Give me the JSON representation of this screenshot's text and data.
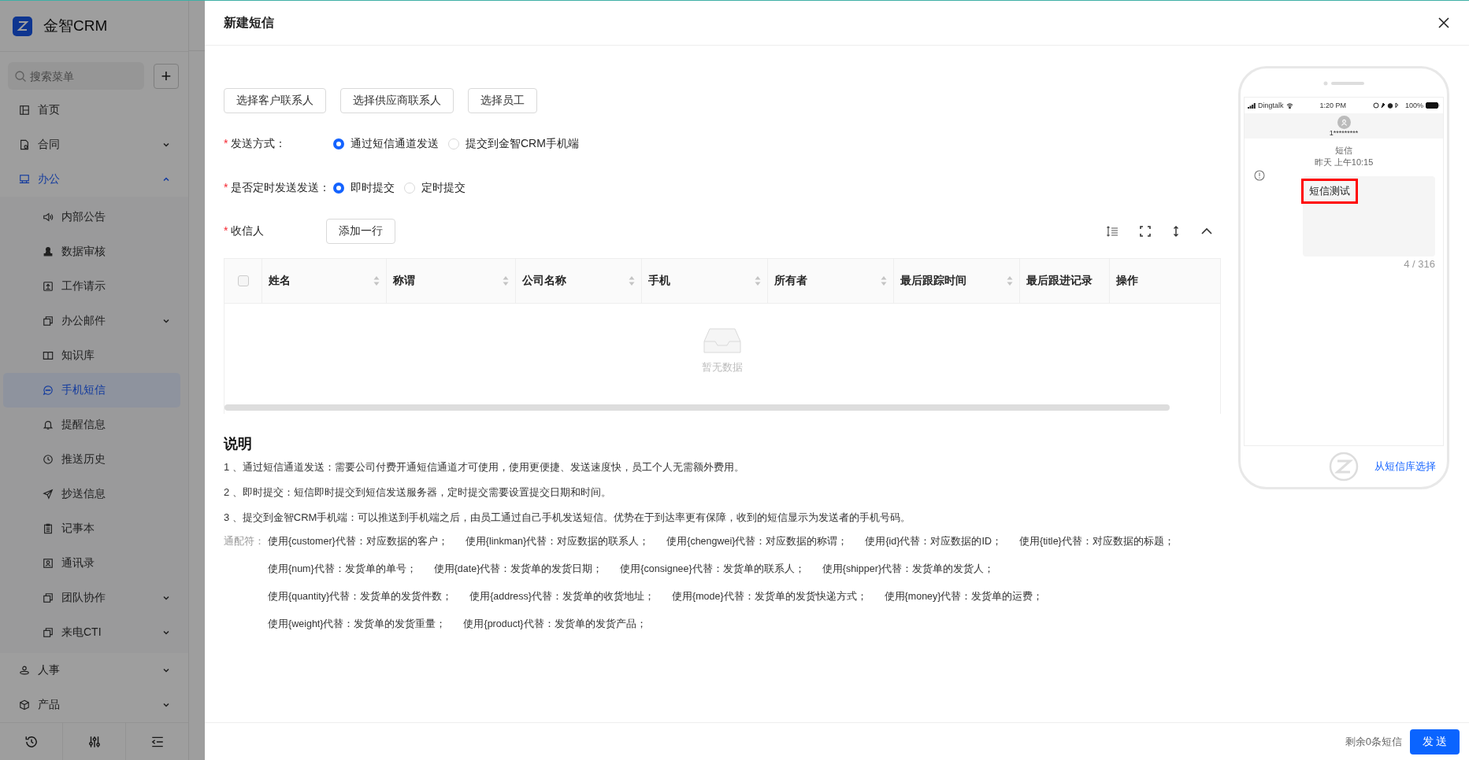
{
  "sidebar": {
    "logo_text": "金智CRM",
    "search": {
      "placeholder": "搜索菜单"
    },
    "add_button": "+",
    "items": [
      {
        "label": "首页",
        "selected": false
      },
      {
        "label": "合同",
        "selected": false,
        "expanded": false
      },
      {
        "label": "办公",
        "selected": false,
        "expanded": true,
        "children": [
          {
            "label": "内部公告",
            "selected": false
          },
          {
            "label": "数据审核",
            "selected": false
          },
          {
            "label": "工作请示",
            "selected": false
          },
          {
            "label": "办公邮件",
            "selected": false,
            "expanded": false
          },
          {
            "label": "知识库",
            "selected": false
          },
          {
            "label": "手机短信",
            "selected": true
          },
          {
            "label": "提醒信息",
            "selected": false
          },
          {
            "label": "推送历史",
            "selected": false
          },
          {
            "label": "抄送信息",
            "selected": false
          },
          {
            "label": "记事本",
            "selected": false
          },
          {
            "label": "通讯录",
            "selected": false
          },
          {
            "label": "团队协作",
            "selected": false,
            "expanded": false
          },
          {
            "label": "来电CTI",
            "selected": false,
            "expanded": false
          }
        ]
      },
      {
        "label": "人事",
        "selected": false,
        "expanded": false
      },
      {
        "label": "产品",
        "selected": false,
        "expanded": false
      }
    ]
  },
  "drawer": {
    "title": "新建短信",
    "pick_buttons": [
      "选择客户联系人",
      "选择供应商联系人",
      "选择员工"
    ],
    "fields": [
      {
        "mark": "*",
        "label": "发送方式：",
        "options": [
          {
            "label": "通过短信通道发送",
            "selected": true
          },
          {
            "label": "提交到金智CRM手机端",
            "selected": false
          }
        ]
      },
      {
        "mark": "*",
        "label": "是否定时发送发送：",
        "options": [
          {
            "label": "即时提交",
            "selected": true
          },
          {
            "label": "定时提交",
            "selected": false
          }
        ]
      }
    ],
    "recipients": {
      "mark": "*",
      "label": "收信人",
      "add_button": "添加一行",
      "table": {
        "select_all": {
          "checked": false
        },
        "columns": [
          {
            "label": "姓名",
            "sortable": true
          },
          {
            "label": "称谓",
            "sortable": true
          },
          {
            "label": "公司名称",
            "sortable": true
          },
          {
            "label": "手机",
            "sortable": true
          },
          {
            "label": "所有者",
            "sortable": true
          },
          {
            "label": "最后跟踪时间",
            "sortable": true
          },
          {
            "label": "最后跟进记录",
            "sortable": false
          },
          {
            "label": "操作",
            "sortable": false
          }
        ],
        "empty_text": "暂无数据"
      }
    },
    "notes": {
      "title": "说明",
      "lines": [
        "1 、通过短信通道发送：需要公司付费开通短信通道才可使用，使用更便捷、发送速度快，员工个人无需额外费用。",
        "2 、即时提交：短信即时提交到短信发送服务器，定时提交需要设置提交日期和时间。",
        "3 、提交到金智CRM手机端：可以推送到手机端之后，由员工通过自己手机发送短信。优势在于到达率更有保障，收到的短信显示为发送者的手机号码。"
      ],
      "placeholders_label": "通配符：",
      "placeholders": [
        [
          "使用{customer}代替：对应数据的客户；",
          "使用{linkman}代替：对应数据的联系人；",
          "使用{chengwei}代替：对应数据的称谓；",
          "使用{id}代替：对应数据的ID；",
          "使用{title}代替：对应数据的标题；"
        ],
        [
          "使用{num}代替：发货单的单号；",
          "使用{date}代替：发货单的发货日期；",
          "使用{consignee}代替：发货单的联系人；",
          "使用{shipper}代替：发货单的发货人；"
        ],
        [
          "使用{quantity}代替：发货单的发货件数；",
          "使用{address}代替：发货单的收货地址；",
          "使用{mode}代替：发货单的发货快递方式；",
          "使用{money}代替：发货单的运费；"
        ],
        [
          "使用{weight}代替：发货单的发货重量；",
          "使用{product}代替：发货单的发货产品；"
        ]
      ]
    },
    "phone": {
      "carrier": "Dingtalk",
      "time": "1:20 PM",
      "battery": "100%",
      "contact": "1*********",
      "thread_label": "短信",
      "timestamp": "昨天 上午10:15",
      "message": "短信测试",
      "counter": "4 / 316",
      "library_link": "从短信库选择"
    },
    "footer": {
      "remaining": "剩余0条短信",
      "send_button": "发 送"
    }
  }
}
